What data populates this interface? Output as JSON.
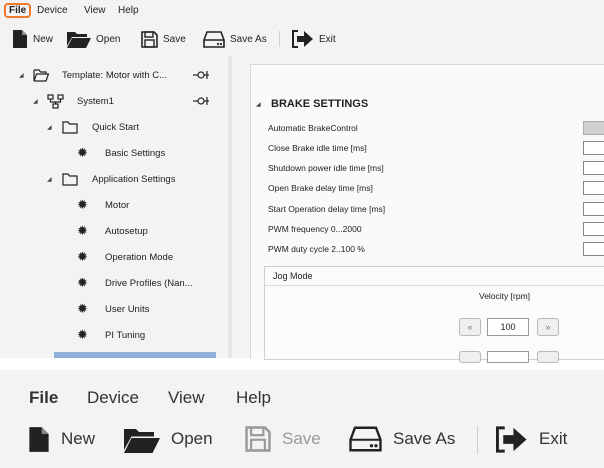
{
  "menu": {
    "file": "File",
    "device": "Device",
    "view": "View",
    "help": "Help"
  },
  "toolbar": {
    "new": "New",
    "open": "Open",
    "save": "Save",
    "save_as": "Save As",
    "exit": "Exit"
  },
  "tree": {
    "template": "Template: Motor with C...",
    "system": "System1",
    "quick_start": "Quick Start",
    "basic_settings": "Basic Settings",
    "application_settings": "Application Settings",
    "motor": "Motor",
    "autosetup": "Autosetup",
    "operation_mode": "Operation Mode",
    "drive_profiles": "Drive Profiles (Nan...",
    "user_units": "User Units",
    "pi_tuning": "PI Tuning"
  },
  "brake": {
    "title": "BRAKE SETTINGS",
    "params": [
      "Automatic BrakeControl",
      "Close Brake idle time [ms]",
      "Shutdown power idle time [ms]",
      "Open Brake delay time [ms]",
      "Start Operation delay time [ms]",
      "PWM frequency 0...2000",
      "PWM duty cycle 2..100 %"
    ]
  },
  "jog": {
    "title": "Jog Mode",
    "velocity_label": "Velocity [rpm]",
    "velocity_value": "100",
    "dec": "«",
    "inc": "»"
  },
  "zoomed": {
    "menu": {
      "file": "File",
      "device": "Device",
      "view": "View",
      "help": "Help"
    },
    "toolbar": {
      "new": "New",
      "open": "Open",
      "save": "Save",
      "save_as": "Save As",
      "exit": "Exit"
    }
  },
  "colors": {
    "accent_file": "#f07a2a",
    "selection": "#8fb0d9",
    "panel_bg": "#f3f3f3"
  }
}
